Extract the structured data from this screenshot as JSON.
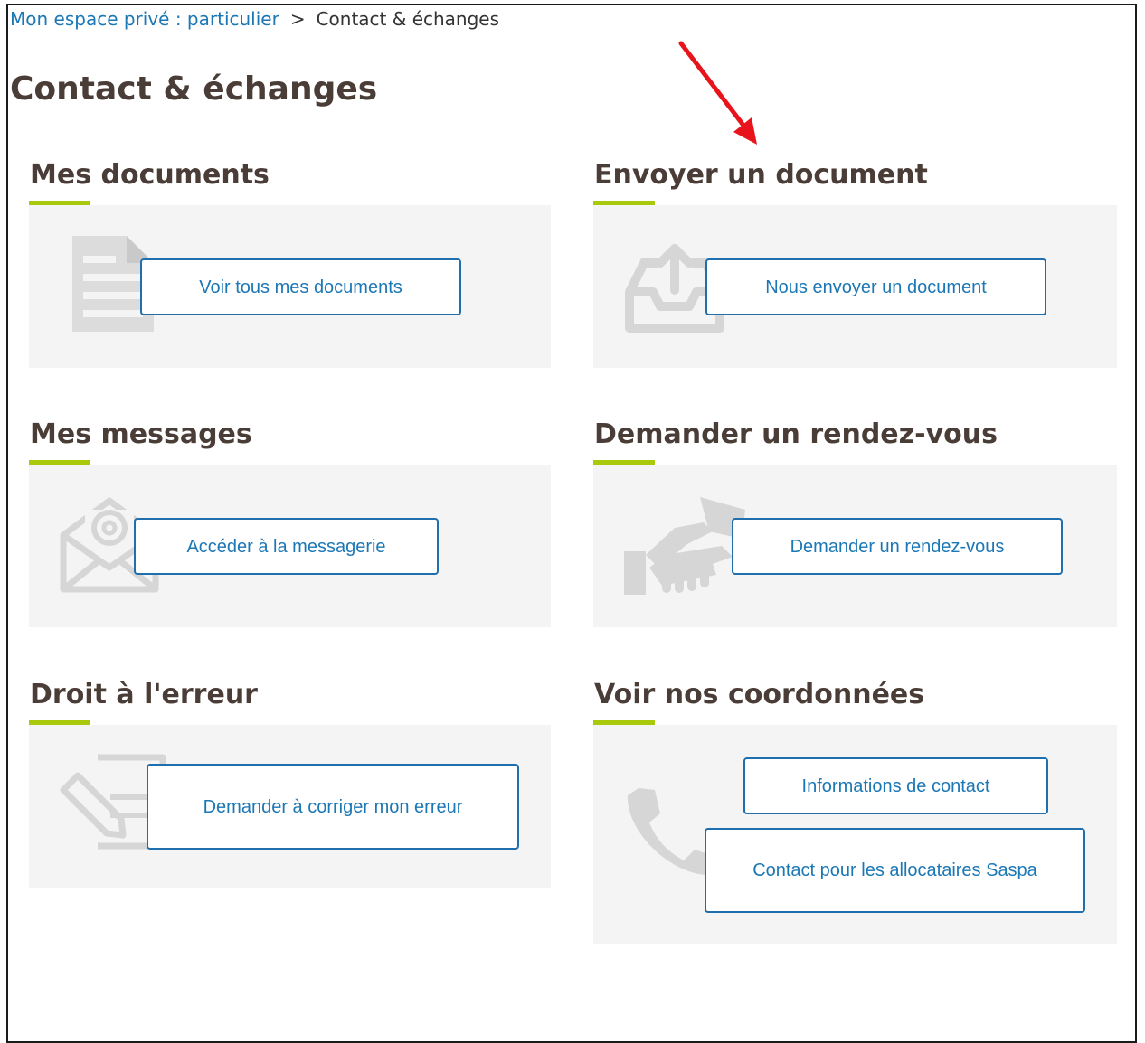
{
  "breadcrumb": {
    "home": "Mon espace privé : particulier",
    "separator": ">",
    "current": "Contact & échanges"
  },
  "page_title": "Contact & échanges",
  "colors": {
    "title": "#4a3c36",
    "link": "#1c77b5",
    "accent": "#a9c90d",
    "panel": "#f4f4f4",
    "arrow": "#e8141b"
  },
  "sections": {
    "documents": {
      "title": "Mes documents",
      "button": "Voir tous mes documents",
      "icon": "document-icon"
    },
    "send": {
      "title": "Envoyer un document",
      "button": "Nous envoyer un document",
      "icon": "upload-tray-icon"
    },
    "messages": {
      "title": "Mes messages",
      "button": "Accéder à la messagerie",
      "icon": "mail-at-icon"
    },
    "appointment": {
      "title": "Demander un rendez-vous",
      "button": "Demander un rendez-vous",
      "icon": "handshake-icon"
    },
    "error": {
      "title": "Droit à l'erreur",
      "button": "Demander à corriger mon erreur",
      "icon": "edit-document-icon"
    },
    "contacts": {
      "title": "Voir nos coordonnées",
      "button_info": "Informations de contact",
      "button_saspa": "Contact pour les allocataires Saspa",
      "icon": "phone-icon"
    }
  }
}
